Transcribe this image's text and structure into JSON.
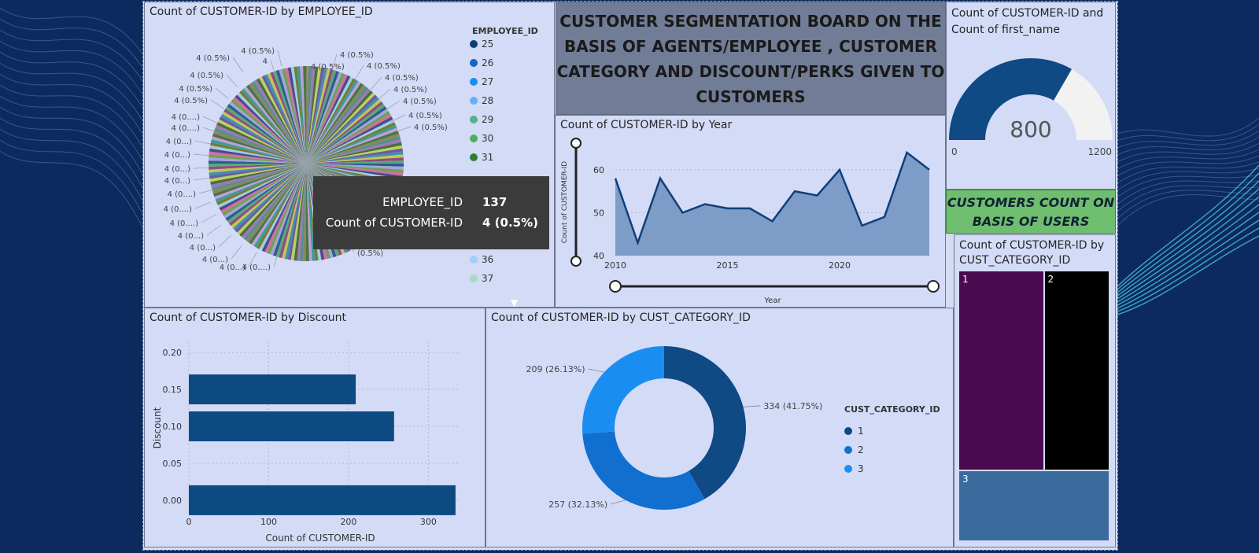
{
  "title": "CUSTOMER SEGMENTATION BOARD ON THE BASIS OF AGENTS/EMPLOYEE , CUSTOMER CATEGORY AND  DISCOUNT/PERKS GIVEN TO CUSTOMERS",
  "title_lines": [
    "CUSTOMER SEGMENTATION BOARD ON THE",
    "BASIS OF AGENTS/EMPLOYEE , CUSTOMER",
    "CATEGORY AND  DISCOUNT/PERKS GIVEN TO",
    "CUSTOMERS"
  ],
  "green_label_lines": [
    "CUSTOMERS COUNT ON",
    "BASIS OF USERS"
  ],
  "tooltip": {
    "field1_label": "EMPLOYEE_ID",
    "field1_value": "137",
    "field2_label": "Count of CUSTOMER-ID",
    "field2_value": "4 (0.5%)"
  },
  "colors": {
    "navy": "#0d3f7a",
    "bar": "#0e4a82",
    "area_line": "#0f3f78",
    "area_fill": "#7e9cc8",
    "gauge_fill": "#0f4a84",
    "gauge_rest": "#f2f2f2",
    "tm1": "#4a0a4f",
    "tm2": "#000000",
    "tm3": "#3a6b9c",
    "green_box": "#6fbe70",
    "title_box": "#717d96"
  },
  "chart_data": [
    {
      "type": "pie",
      "title": "Count of CUSTOMER-ID by EMPLOYEE_ID",
      "legend_title": "EMPLOYEE_ID",
      "legend_entries": [
        "25",
        "26",
        "27",
        "28",
        "29",
        "30",
        "31",
        "36",
        "37"
      ],
      "legend_colors": [
        "#0d3f7a",
        "#1167c5",
        "#1a8ef0",
        "#62b2f5",
        "#4fb38f",
        "#50ad60",
        "#2e7d36",
        "#9fd0f5",
        "#a8dcc0"
      ],
      "slice_count": 200,
      "slice_value": 4,
      "slice_label": "4 (0.5%)",
      "data_labels": [
        "4 (0.5%)",
        "4 (0.5%)",
        "4 (0.5%)",
        "4 (0.5%)",
        "4 (0....)",
        "4 (0....)",
        "4 (0...)",
        "4 (0...)",
        "4 (0...)",
        "4 (0...)",
        "4 (0....)",
        "4 (0....)",
        "4 (0....)",
        "4 (0...)",
        "4 (0...)",
        "4 (0...)",
        "4 (0...)",
        "4 (0....)",
        "4 (0.5%)",
        "4 (0.5%)",
        "4 (0.5%)",
        "4 (0.5%)",
        "4 (0.5%)",
        "4 (0.5%)",
        "4 (0.5%)",
        "4 (0.5%)",
        "4",
        "(0.5%)",
        "4 (0.5%)",
        "4 (0.5%)",
        "4 (0.5%)",
        "4 (0.5%)",
        "4 (0.5%)",
        "4 (0...)"
      ],
      "scroll_glyph": "▼"
    },
    {
      "type": "area",
      "title": "Count of CUSTOMER-ID by Year",
      "xlabel": "Year",
      "ylabel": "Count of CUSTOMER-ID",
      "x": [
        2010,
        2011,
        2012,
        2013,
        2014,
        2015,
        2016,
        2017,
        2018,
        2019,
        2020,
        2021,
        2022,
        2023,
        2024
      ],
      "y": [
        58,
        43,
        58,
        50,
        52,
        51,
        51,
        48,
        55,
        54,
        60,
        47,
        49,
        64,
        60
      ],
      "xlim": [
        2010,
        2024
      ],
      "ylim": [
        40,
        66
      ],
      "xticks": [
        "2010",
        "2015",
        "2020"
      ],
      "yticks": [
        "40",
        "50",
        "60"
      ],
      "grid": true
    },
    {
      "type": "gauge",
      "title_lines": [
        "Count of CUSTOMER-ID and",
        "Count of first_name"
      ],
      "value": 800,
      "value_label": "800",
      "min_label": "0",
      "max_label": "1200",
      "min": 0,
      "max": 1200
    },
    {
      "type": "bar",
      "orientation": "horizontal",
      "title": "Count of CUSTOMER-ID by Discount",
      "xlabel": "Count of CUSTOMER-ID",
      "ylabel": "Discount",
      "categories": [
        "0.00",
        "0.10",
        "0.15"
      ],
      "category_values": [
        0.0,
        0.1,
        0.15
      ],
      "values": [
        334,
        257,
        209
      ],
      "xticks": [
        "0",
        "100",
        "200",
        "300"
      ],
      "yticks": [
        "0.00",
        "0.05",
        "0.10",
        "0.15",
        "0.20"
      ],
      "xlim": [
        0,
        340
      ],
      "ylim": [
        -0.015,
        0.215
      ],
      "grid": true
    },
    {
      "type": "pie",
      "subtype": "donut",
      "title": "Count of CUSTOMER-ID by CUST_CATEGORY_ID",
      "legend_title": "CUST_CATEGORY_ID",
      "categories": [
        "1",
        "2",
        "3"
      ],
      "values": [
        334,
        257,
        209
      ],
      "labels": [
        "334 (41.75%)",
        "257 (32.13%)",
        "209 (26.13%)"
      ],
      "colors": [
        "#0f4a84",
        "#1170cf",
        "#1a8ef0"
      ]
    },
    {
      "type": "treemap",
      "title_lines": [
        "Count of CUSTOMER-ID by",
        "CUST_CATEGORY_ID"
      ],
      "categories": [
        "1",
        "2",
        "3"
      ],
      "values": [
        334,
        257,
        209
      ],
      "colors": [
        "#4a0a4f",
        "#000000",
        "#3a6b9c"
      ]
    }
  ]
}
